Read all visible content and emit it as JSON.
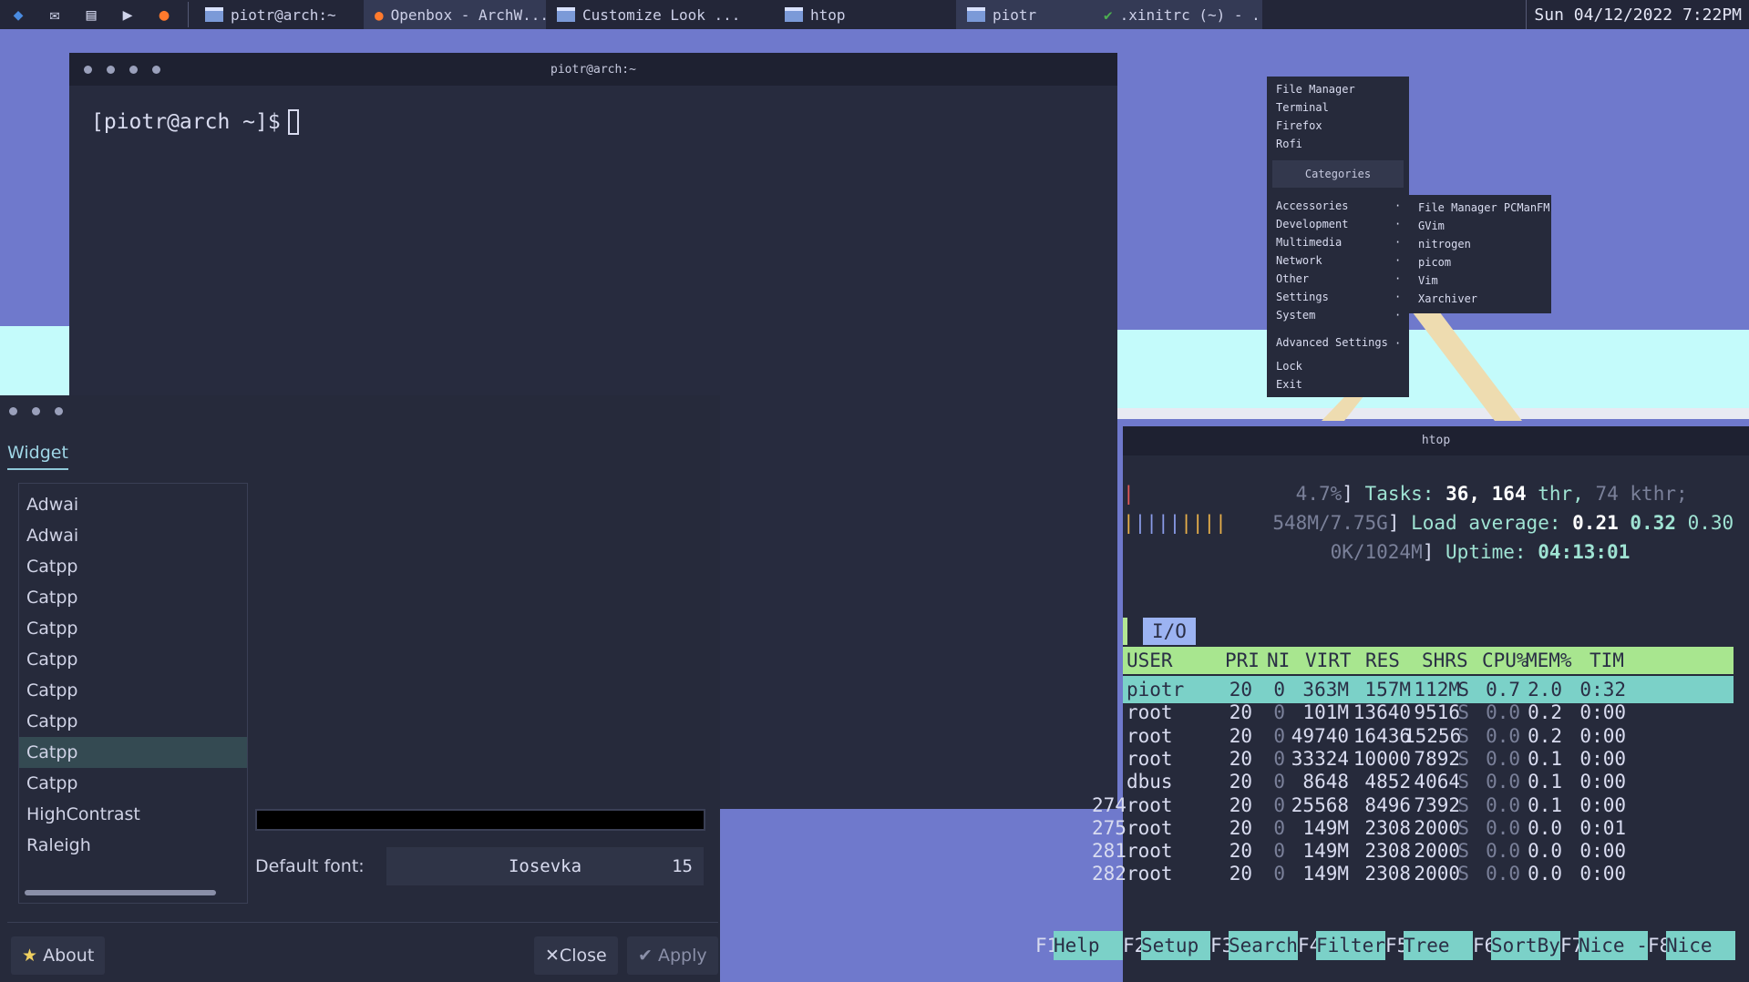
{
  "panel": {
    "launchers": [
      {
        "name": "app-launcher-icon",
        "glyph": "◆"
      },
      {
        "name": "mail-icon",
        "glyph": "✉"
      },
      {
        "name": "notes-icon",
        "glyph": "▤"
      },
      {
        "name": "terminal-icon",
        "glyph": "▶"
      },
      {
        "name": "firefox-icon",
        "glyph": "●"
      }
    ],
    "tasks": [
      {
        "label": "piotr@arch:~",
        "active": false
      },
      {
        "label": "Openbox - ArchW...",
        "active": true
      },
      {
        "label": "Customize Look ...",
        "active": false
      },
      {
        "label": "htop",
        "active": false
      },
      {
        "label": "piotr",
        "active": true
      },
      {
        "label": ".xinitrc (~) - ...",
        "active": true
      }
    ],
    "clock": "Sun 04/12/2022 7:22PM"
  },
  "terminal": {
    "title": "piotr@arch:~",
    "prompt": "[piotr@arch ~]$"
  },
  "look": {
    "tab": "Widget",
    "themes": [
      "Adwai",
      "Adwai",
      "Catpp",
      "Catpp",
      "Catpp",
      "Catpp",
      "Catpp",
      "Catpp",
      "Catpp",
      "Catpp",
      "HighContrast",
      "Raleigh"
    ],
    "selected_index": 8,
    "default_font_label": "Default font:",
    "font_name": "Iosevka",
    "font_size": "15",
    "about_label": "About",
    "close_label": "Close",
    "apply_label": "Apply"
  },
  "htop": {
    "title": "htop",
    "cpu": "4.7%",
    "mem": "548M/7.75G",
    "swp": "0K/1024M",
    "tasks_label": "Tasks:",
    "tasks": "36,",
    "thr": "164",
    "thr_label": "thr,",
    "kthr": "74 kthr;",
    "load_label": "Load average:",
    "load1": "0.21",
    "load5": "0.32",
    "load15": "0.30",
    "uptime_label": "Uptime:",
    "uptime": "04:13:01",
    "io_tab": "I/O",
    "columns": [
      "USER",
      "PRI",
      "NI",
      "VIRT",
      "RES",
      "SHR",
      "S",
      "CPU%",
      "MEM%",
      "TIM"
    ],
    "rows": [
      {
        "pid": "",
        "user": "piotr",
        "pri": "20",
        "ni": "0",
        "virt": "363M",
        "res": "157M",
        "shr": "112M",
        "s": "S",
        "cpu": "0.7",
        "mem": "2.0",
        "time": "0:32"
      },
      {
        "pid": "",
        "user": "root",
        "pri": "20",
        "ni": "0",
        "virt": "101M",
        "res": "13640",
        "shr": "9516",
        "s": "S",
        "cpu": "0.0",
        "mem": "0.2",
        "time": "0:00"
      },
      {
        "pid": "",
        "user": "root",
        "pri": "20",
        "ni": "0",
        "virt": "49740",
        "res": "16436",
        "shr": "15256",
        "s": "S",
        "cpu": "0.0",
        "mem": "0.2",
        "time": "0:00"
      },
      {
        "pid": "",
        "user": "root",
        "pri": "20",
        "ni": "0",
        "virt": "33324",
        "res": "10000",
        "shr": "7892",
        "s": "S",
        "cpu": "0.0",
        "mem": "0.1",
        "time": "0:00"
      },
      {
        "pid": "",
        "user": "dbus",
        "pri": "20",
        "ni": "0",
        "virt": "8648",
        "res": "4852",
        "shr": "4064",
        "s": "S",
        "cpu": "0.0",
        "mem": "0.1",
        "time": "0:00"
      },
      {
        "pid": "274",
        "user": "root",
        "pri": "20",
        "ni": "0",
        "virt": "25568",
        "res": "8496",
        "shr": "7392",
        "s": "S",
        "cpu": "0.0",
        "mem": "0.1",
        "time": "0:00"
      },
      {
        "pid": "275",
        "user": "root",
        "pri": "20",
        "ni": "0",
        "virt": "149M",
        "res": "2308",
        "shr": "2000",
        "s": "S",
        "cpu": "0.0",
        "mem": "0.0",
        "time": "0:01"
      },
      {
        "pid": "281",
        "user": "root",
        "pri": "20",
        "ni": "0",
        "virt": "149M",
        "res": "2308",
        "shr": "2000",
        "s": "S",
        "cpu": "0.0",
        "mem": "0.0",
        "time": "0:00"
      },
      {
        "pid": "282",
        "user": "root",
        "pri": "20",
        "ni": "0",
        "virt": "149M",
        "res": "2308",
        "shr": "2000",
        "s": "S",
        "cpu": "0.0",
        "mem": "0.0",
        "time": "0:00"
      }
    ],
    "fkeys": [
      {
        "key": "F1",
        "label": "Help  "
      },
      {
        "key": "F2",
        "label": "Setup "
      },
      {
        "key": "F3",
        "label": "Search"
      },
      {
        "key": "F4",
        "label": "Filter"
      },
      {
        "key": "F5",
        "label": "Tree  "
      },
      {
        "key": "F6",
        "label": "SortBy"
      },
      {
        "key": "F7",
        "label": "Nice -"
      },
      {
        "key": "F8",
        "label": "Nice  "
      }
    ]
  },
  "menu": {
    "top_items": [
      "File Manager",
      "Terminal",
      "Firefox",
      "Rofi"
    ],
    "categories_header": "Categories",
    "categories": [
      "Accessories",
      "Development",
      "Multimedia",
      "Network",
      "Other",
      "Settings",
      "System"
    ],
    "advanced": "Advanced Settings",
    "bottom_items": [
      "Lock",
      "Exit"
    ],
    "submenu": [
      "File Manager PCManFM",
      "GVim",
      "nitrogen",
      "picom",
      "Vim",
      "Xarchiver"
    ]
  }
}
